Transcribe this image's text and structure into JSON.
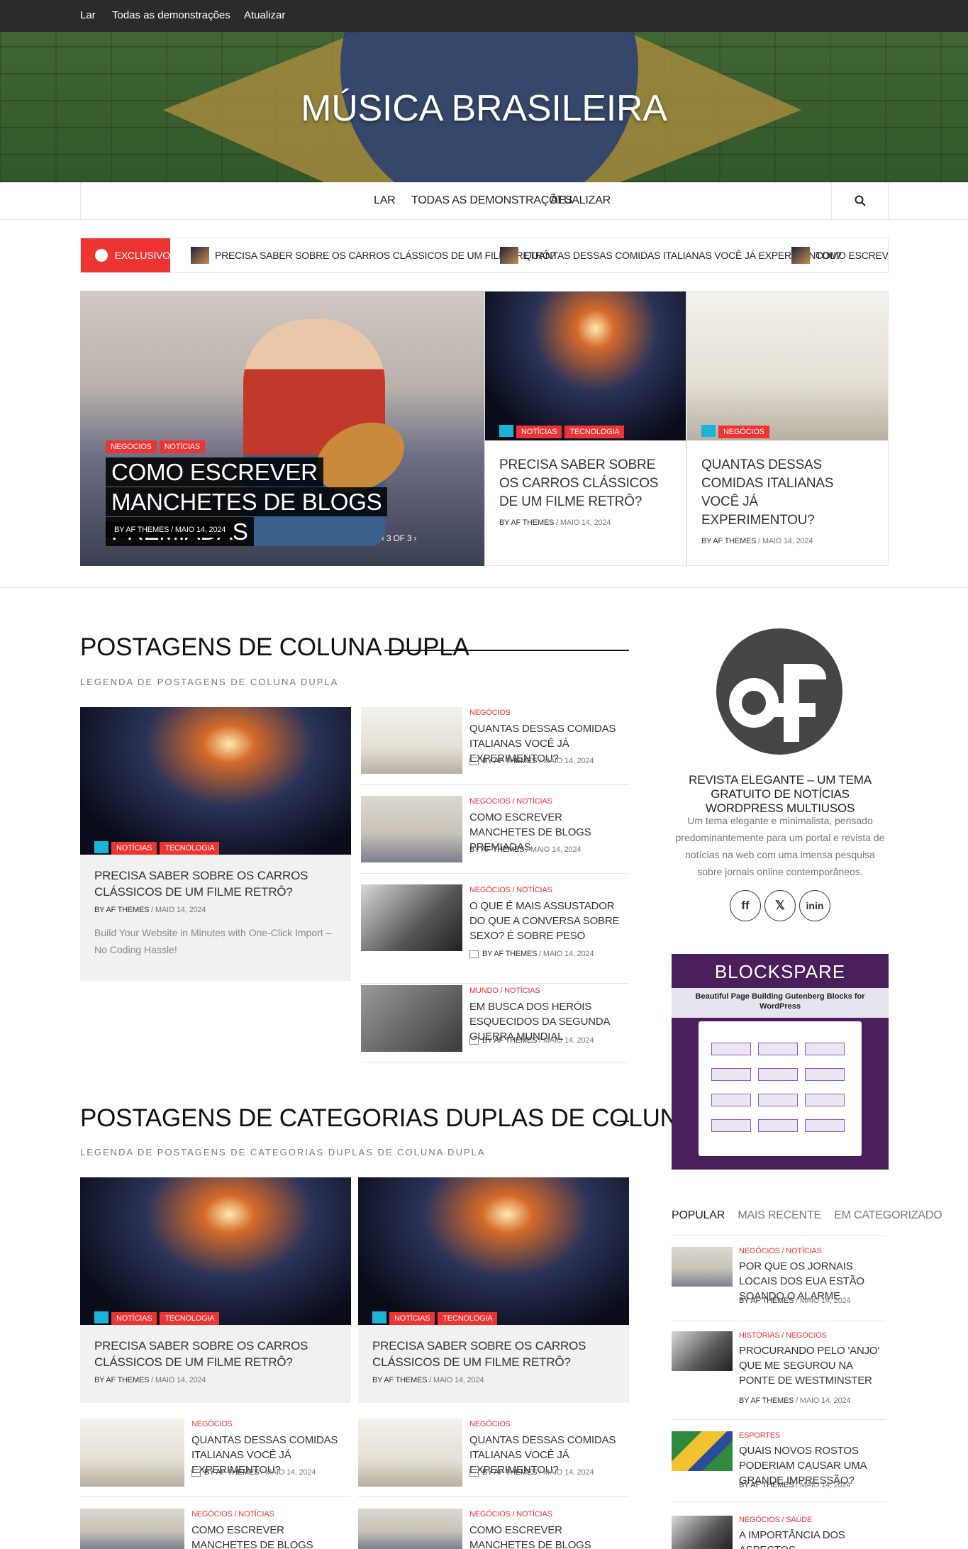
{
  "topbar": {
    "items": [
      "Lar",
      "Todas as demonstrações",
      "Atualizar"
    ]
  },
  "site": {
    "title": "MÚSICA BRASILEIRA"
  },
  "nav": {
    "items": [
      "LAR",
      "TODAS AS DEMONSTRAÇÕES",
      "ATUALIZAR"
    ],
    "search_icon": "search-icon"
  },
  "ticker": {
    "label": "EXCLUSIVO",
    "items": [
      "PRECISA SABER SOBRE OS CARROS CLÁSSICOS DE UM FILME RETRÔ?",
      "QUANTAS DESSAS COMIDAS ITALIANAS VOCÊ JÁ EXPERIMENTOU?",
      "COMO ESCREVER M"
    ]
  },
  "hero": {
    "main": {
      "tags": [
        "NEGÓCIOS",
        "NOTÍCIAS"
      ],
      "title": "COMO ESCREVER MANCHETES DE BLOGS PREMIADAS",
      "meta": "BY AF THEMES  /  MAIO 14, 2024",
      "pager": "3 OF 3"
    },
    "cards": [
      {
        "tags": [
          "NOTÍCIAS",
          "TECNOLOGIA"
        ],
        "title": "PRECISA SABER SOBRE OS CARROS CLÁSSICOS DE UM FILME RETRÔ?",
        "author": "BY AF THEMES",
        "date": " / MAIO 14, 2024"
      },
      {
        "tags": [
          "NEGÓCIOS"
        ],
        "title": "QUANTAS DESSAS COMIDAS ITALIANAS VOCÊ JÁ EXPERIMENTOU?",
        "author": "BY AF THEMES",
        "date": " / MAIO 14, 2024"
      }
    ]
  },
  "section1": {
    "title": "POSTAGENS DE COLUNA DUPLA",
    "subtitle": "LEGENDA DE POSTAGENS DE COLUNA DUPLA",
    "big": {
      "tags": [
        "NOTÍCIAS",
        "TECNOLOGIA"
      ],
      "title": "PRECISA SABER SOBRE OS CARROS CLÁSSICOS DE UM FILME RETRÔ?",
      "author": "BY AF THEMES",
      "date": " / MAIO 14, 2024",
      "excerpt": "Build Your Website in Minutes with One-Click Import – No Coding Hassle!"
    },
    "list": [
      {
        "cat": "NEGÓCIOS",
        "title": "QUANTAS DESSAS COMIDAS ITALIANAS VOCÊ JÁ EXPERIMENTOU?",
        "author": "BY AF THEMES",
        "date": " / MAIO 14, 2024"
      },
      {
        "cat": "NEGÓCIOS / NOTÍCIAS",
        "title": "COMO ESCREVER MANCHETES DE BLOGS PREMIADAS",
        "author": "BY AF THEMES",
        "date": " / MAIO 14, 2024"
      },
      {
        "cat": "NEGÓCIOS / NOTÍCIAS",
        "title": "O QUE É MAIS ASSUSTADOR DO QUE A CONVERSA SOBRE SEXO? É SOBRE PESO",
        "author": "BY AF THEMES",
        "date": " / MAIO 14, 2024"
      },
      {
        "cat": "MUNDO / NOTÍCIAS",
        "title": "EM BUSCA DOS HERÓIS ESQUECIDOS DA SEGUNDA GUERRA MUNDIAL",
        "author": "BY AF THEMES",
        "date": " / MAIO 14, 2024"
      }
    ]
  },
  "section2": {
    "title": "POSTAGENS DE CATEGORIAS DUPLAS DE COLUNA DUPLA",
    "subtitle": "LEGENDA DE POSTAGENS DE CATEGORIAS DUPLAS DE COLUNA DUPLA",
    "big": {
      "tags": [
        "NOTÍCIAS",
        "TECNOLOGIA"
      ],
      "title": "PRECISA SABER SOBRE OS CARROS CLÁSSICOS DE UM FILME RETRÔ?",
      "author": "BY AF THEMES",
      "date": " / MAIO 14, 2024"
    },
    "small1": {
      "cat": "NEGÓCIOS",
      "title": "QUANTAS DESSAS COMIDAS ITALIANAS VOCÊ JÁ EXPERIMENTOU?",
      "author": "BY AF THEMES",
      "date": " / MAIO 14, 2024"
    },
    "small2": {
      "cat": "NEGÓCIOS / NOTÍCIAS",
      "title": "COMO ESCREVER MANCHETES DE BLOGS PREMIADAS"
    }
  },
  "sidebar": {
    "about_title": "REVISTA ELEGANTE – UM TEMA GRATUITO DE NOTÍCIAS WORDPRESS MULTIUSOS",
    "about_text": "Um tema elegante e minimalista, pensado predominantemente para um portal e revista de notícias na web com uma imensa pesquisa sobre jornais online contemporâneos.",
    "social": [
      "ff",
      "𝕏",
      "inin"
    ],
    "ad": {
      "title": "BLOCKSPARE",
      "subtitle": "Beautiful Page Building Gutenberg Blocks for WordPress"
    },
    "tabs": [
      "POPULAR",
      "MAIS RECENTE",
      "EM CATEGORIZADO"
    ],
    "posts": [
      {
        "cat": "NEGÓCIOS / NOTÍCIAS",
        "title": "POR QUE OS JORNAIS LOCAIS DOS EUA ESTÃO SOANDO O ALARME",
        "author": "BY AF THEMES",
        "date": " / MAIO 14, 2024"
      },
      {
        "cat": "HISTÓRIAS / NEGÓCIOS",
        "title": "PROCURANDO PELO 'ANJO' QUE ME SEGUROU NA PONTE DE WESTMINSTER",
        "author": "BY AF THEMES",
        "date": " / MAIO 14, 2024"
      },
      {
        "cat": "ESPORTES",
        "title": "QUAIS NOVOS ROSTOS PODERIAM CAUSAR UMA GRANDE IMPRESSÃO?",
        "author": "BY AF THEMES",
        "date": " / MAIO 14, 2024"
      },
      {
        "cat": "NEGÓCIOS / SAÚDE",
        "title": "A IMPORTÂNCIA DOS ASPECTOS"
      }
    ]
  },
  "colors": {
    "accent": "#ee3333",
    "topbar": "#2b2b2b",
    "icon_blue": "#1ab4d8",
    "ad_purple": "#4a1f5c"
  }
}
